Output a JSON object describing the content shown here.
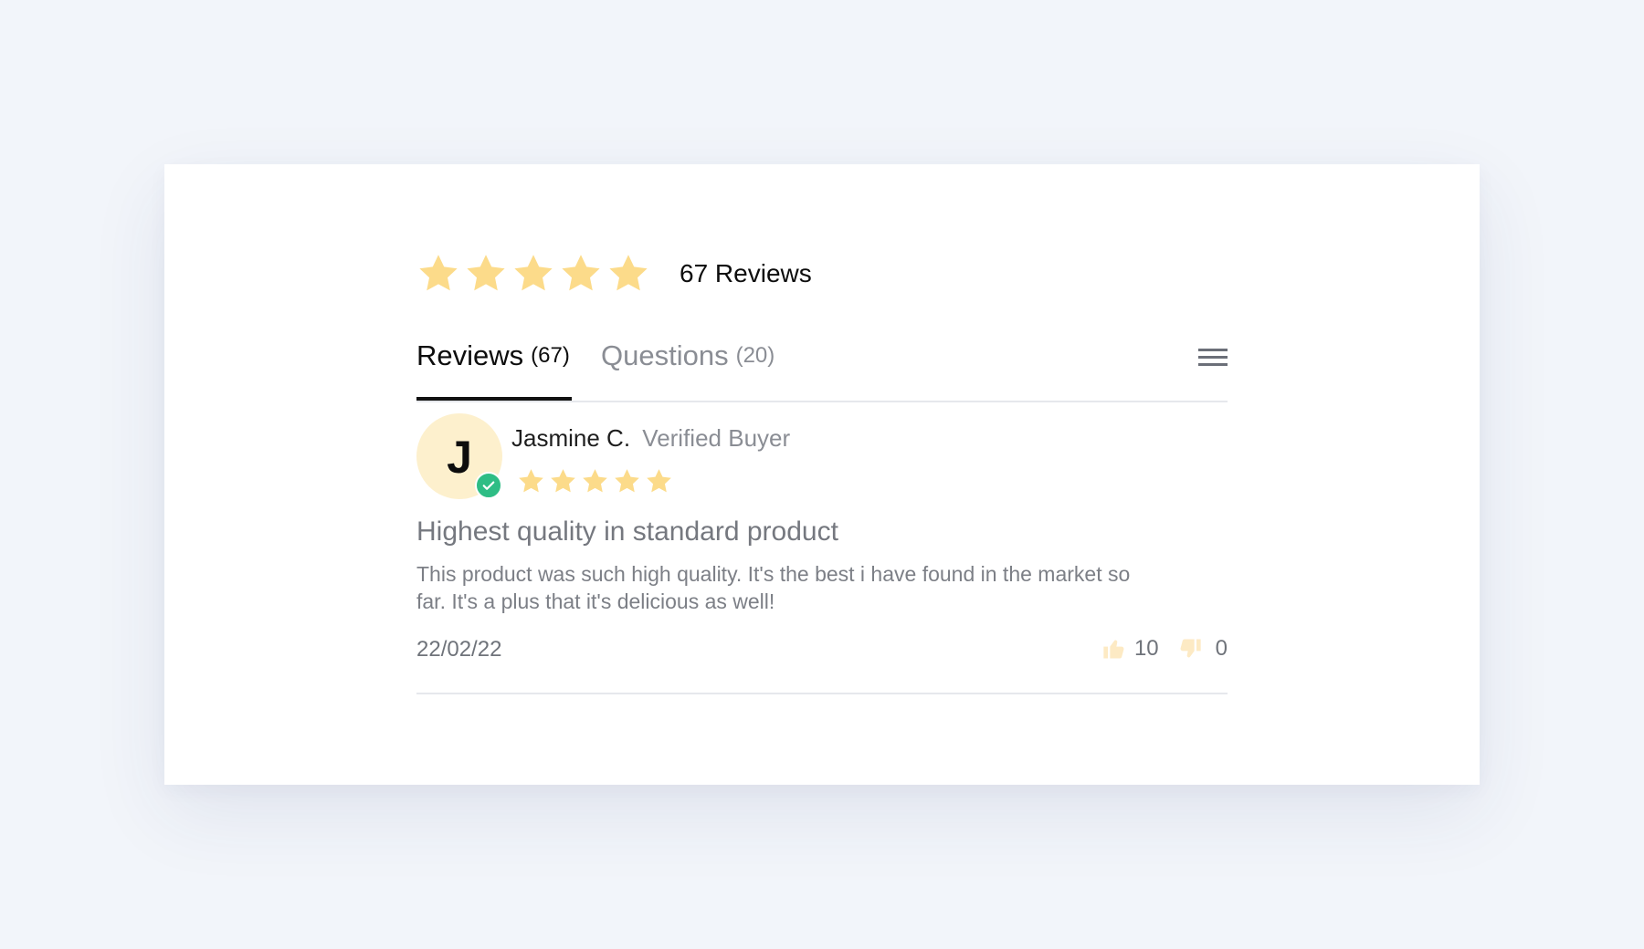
{
  "summary": {
    "rating": 5,
    "max_rating": 5,
    "review_count_label": "67 Reviews"
  },
  "tabs": [
    {
      "label": "Reviews",
      "count": "(67)",
      "active": true
    },
    {
      "label": "Questions",
      "count": "(20)",
      "active": false
    }
  ],
  "icons": {
    "star": "star-icon",
    "menu": "hamburger-menu-icon",
    "verified": "check-circle-icon",
    "thumbs_up": "thumbs-up-icon",
    "thumbs_down": "thumbs-down-icon"
  },
  "colors": {
    "star": "#fcdb8a",
    "avatar_bg": "#fdf0cd",
    "verified": "#2ebd85",
    "active_tab_underline": "#111111"
  },
  "review": {
    "avatar_initial": "J",
    "name": "Jasmine C.",
    "status": "Verified Buyer",
    "rating": 5,
    "title": "Highest quality in standard product",
    "body": "This product was such high quality. It's the best i have found in the market so far. It's a plus that it's delicious as well!",
    "date": "22/02/22",
    "helpful_count": "10",
    "unhelpful_count": "0"
  }
}
